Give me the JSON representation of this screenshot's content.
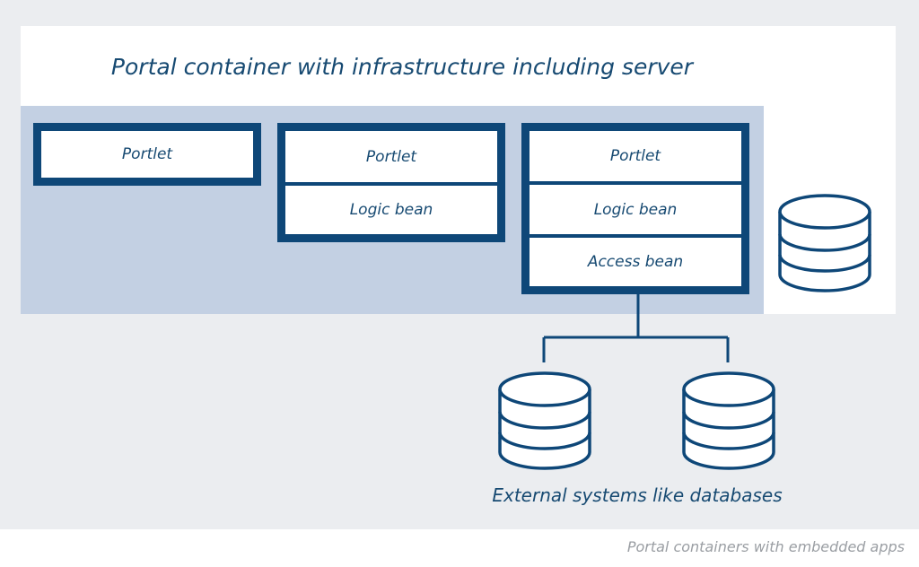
{
  "container": {
    "title": "Portal container with infrastructure including server"
  },
  "apps": [
    {
      "layers": [
        "Portlet"
      ]
    },
    {
      "layers": [
        "Portlet",
        "Logic bean"
      ]
    },
    {
      "layers": [
        "Portlet",
        "Logic bean",
        "Access bean"
      ]
    }
  ],
  "external": {
    "label": "External systems like databases"
  },
  "caption": "Portal containers with embedded apps",
  "colors": {
    "dark_blue": "#0e4778",
    "light_blue": "#c3d0e3",
    "text_blue": "#174a72",
    "caption_gray": "#9a9ea3"
  }
}
